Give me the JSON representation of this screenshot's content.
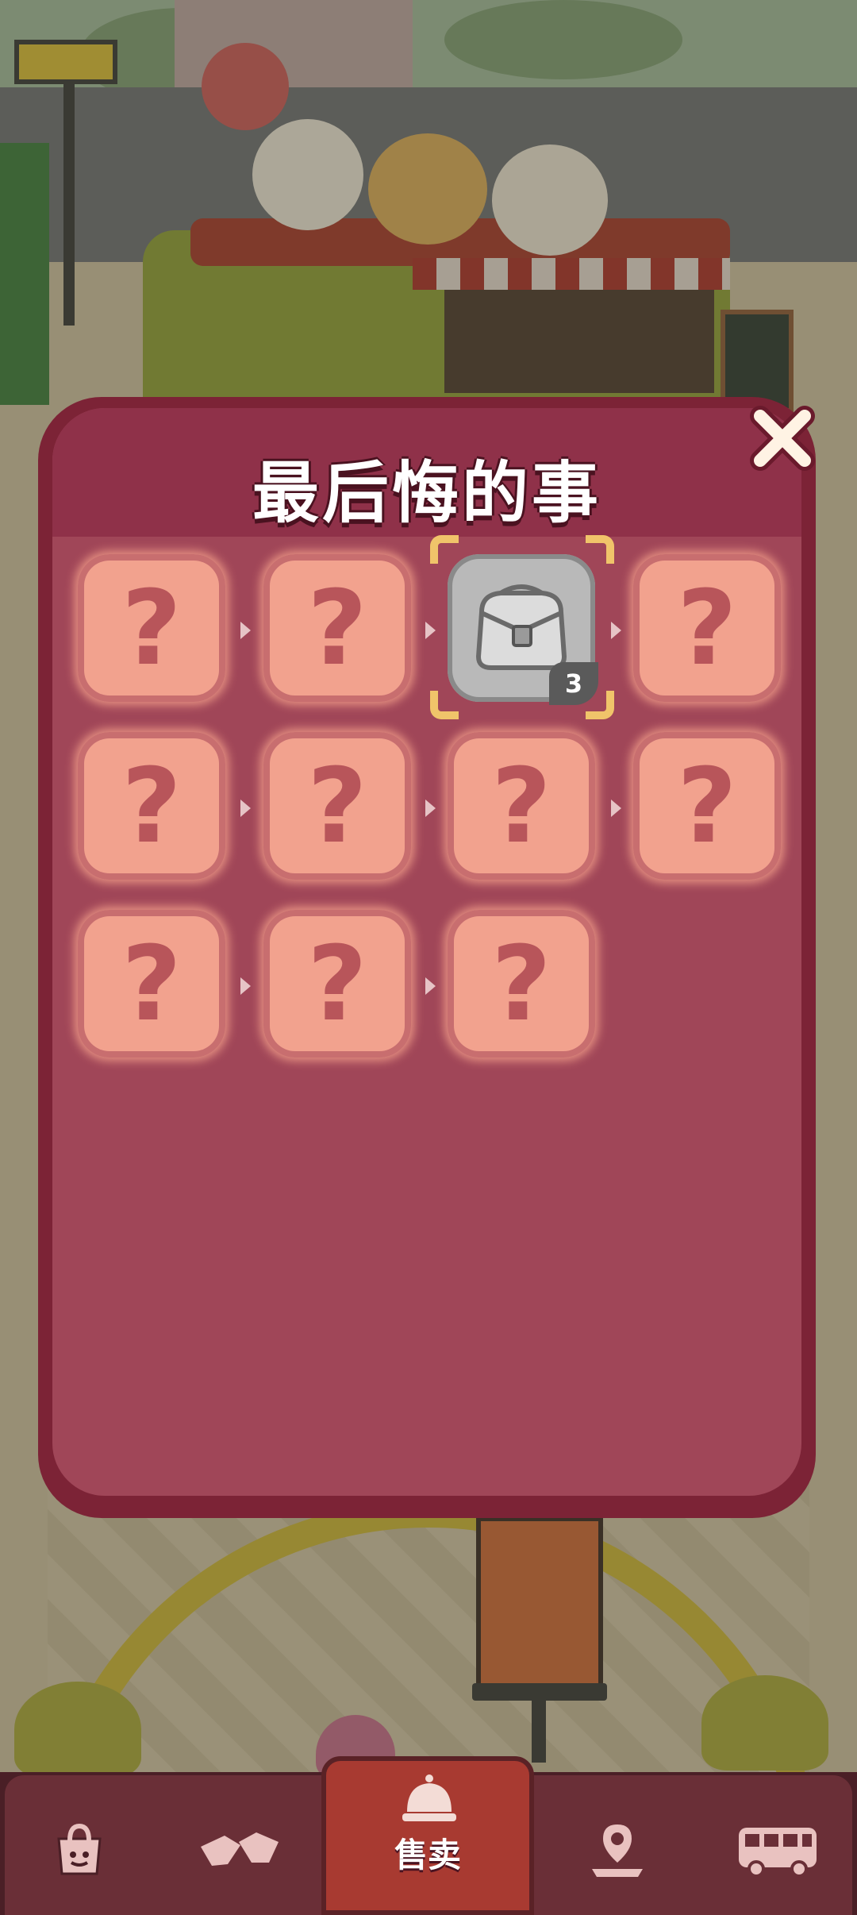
{
  "dialog": {
    "title": "最后悔的事",
    "close_icon": "close-x-icon",
    "items": [
      {
        "state": "locked",
        "label": "?"
      },
      {
        "state": "locked",
        "label": "?"
      },
      {
        "state": "revealed",
        "icon": "bag-icon",
        "count": "3"
      },
      {
        "state": "locked",
        "label": "?"
      },
      {
        "state": "locked",
        "label": "?"
      },
      {
        "state": "locked",
        "label": "?"
      },
      {
        "state": "locked",
        "label": "?"
      },
      {
        "state": "locked",
        "label": "?"
      },
      {
        "state": "locked",
        "label": "?"
      },
      {
        "state": "locked",
        "label": "?"
      },
      {
        "state": "locked",
        "label": "?"
      }
    ]
  },
  "bottom_nav": {
    "items": [
      {
        "icon": "shopping-bag-icon"
      },
      {
        "icon": "handshake-icon"
      },
      {
        "icon": "service-bell-icon",
        "label": "售卖",
        "active": true
      },
      {
        "icon": "map-pin-icon"
      },
      {
        "icon": "bus-icon"
      }
    ]
  },
  "colors": {
    "dialog_border": "#7c2336",
    "dialog_bg": "#a04658",
    "cell_bg": "#f2a28e",
    "highlight": "#f0c46a",
    "nav_active": "#a83a31"
  }
}
